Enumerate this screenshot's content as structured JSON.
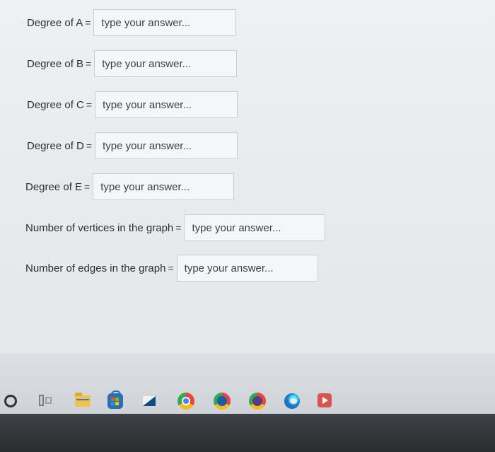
{
  "form": {
    "degree_a_label": "Degree of A",
    "degree_b_label": "Degree of B",
    "degree_c_label": "Degree of C",
    "degree_d_label": "Degree of D",
    "degree_e_label": "Degree of E",
    "vertices_label": "Number of vertices in the graph",
    "edges_label": "Number of edges in the graph",
    "equals": "=",
    "placeholder": "type your answer..."
  },
  "taskbar": {
    "icons": [
      "search-circle-icon",
      "task-view-icon",
      "file-explorer-icon",
      "store-icon",
      "mail-icon",
      "chrome-icon",
      "chrome-profile-icon",
      "chrome-profile-2-icon",
      "edge-icon",
      "media-icon"
    ],
    "colors": {
      "chrome": "#e8453c",
      "edge": "#1f7ec7",
      "folder": "#f2c14e",
      "store": "#2a6fb3"
    }
  }
}
